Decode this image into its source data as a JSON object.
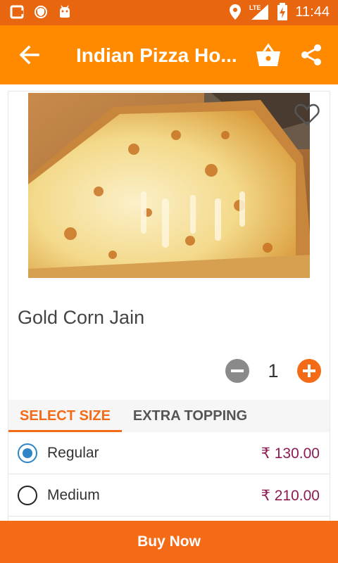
{
  "status_bar": {
    "time": "11:44",
    "network": "LTE",
    "icons": [
      "cast-icon",
      "vpn-icon",
      "android-icon",
      "location-icon",
      "signal-icon",
      "battery-charging-icon"
    ]
  },
  "app_bar": {
    "title": "Indian Pizza Ho...",
    "icons": [
      "back-arrow-icon",
      "cart-basket-icon",
      "share-icon"
    ]
  },
  "product": {
    "name": "Gold Corn Jain",
    "quantity": "1",
    "image_icon": "pizza-slice-image",
    "favorite_icon": "heart-outline-icon"
  },
  "tabs": [
    {
      "label": "SELECT SIZE",
      "active": true
    },
    {
      "label": "EXTRA TOPPING",
      "active": false
    }
  ],
  "sizes": [
    {
      "label": "Regular",
      "price": "₹ 130.00",
      "selected": true
    },
    {
      "label": "Medium",
      "price": "₹ 210.00",
      "selected": false
    }
  ],
  "actions": {
    "buy_now": "Buy Now"
  },
  "colors": {
    "status_bar": "#e8660f",
    "app_bar": "#ff8a00",
    "accent": "#f36a17",
    "price": "#8e1b54",
    "radio_selected": "#2f86c6"
  }
}
